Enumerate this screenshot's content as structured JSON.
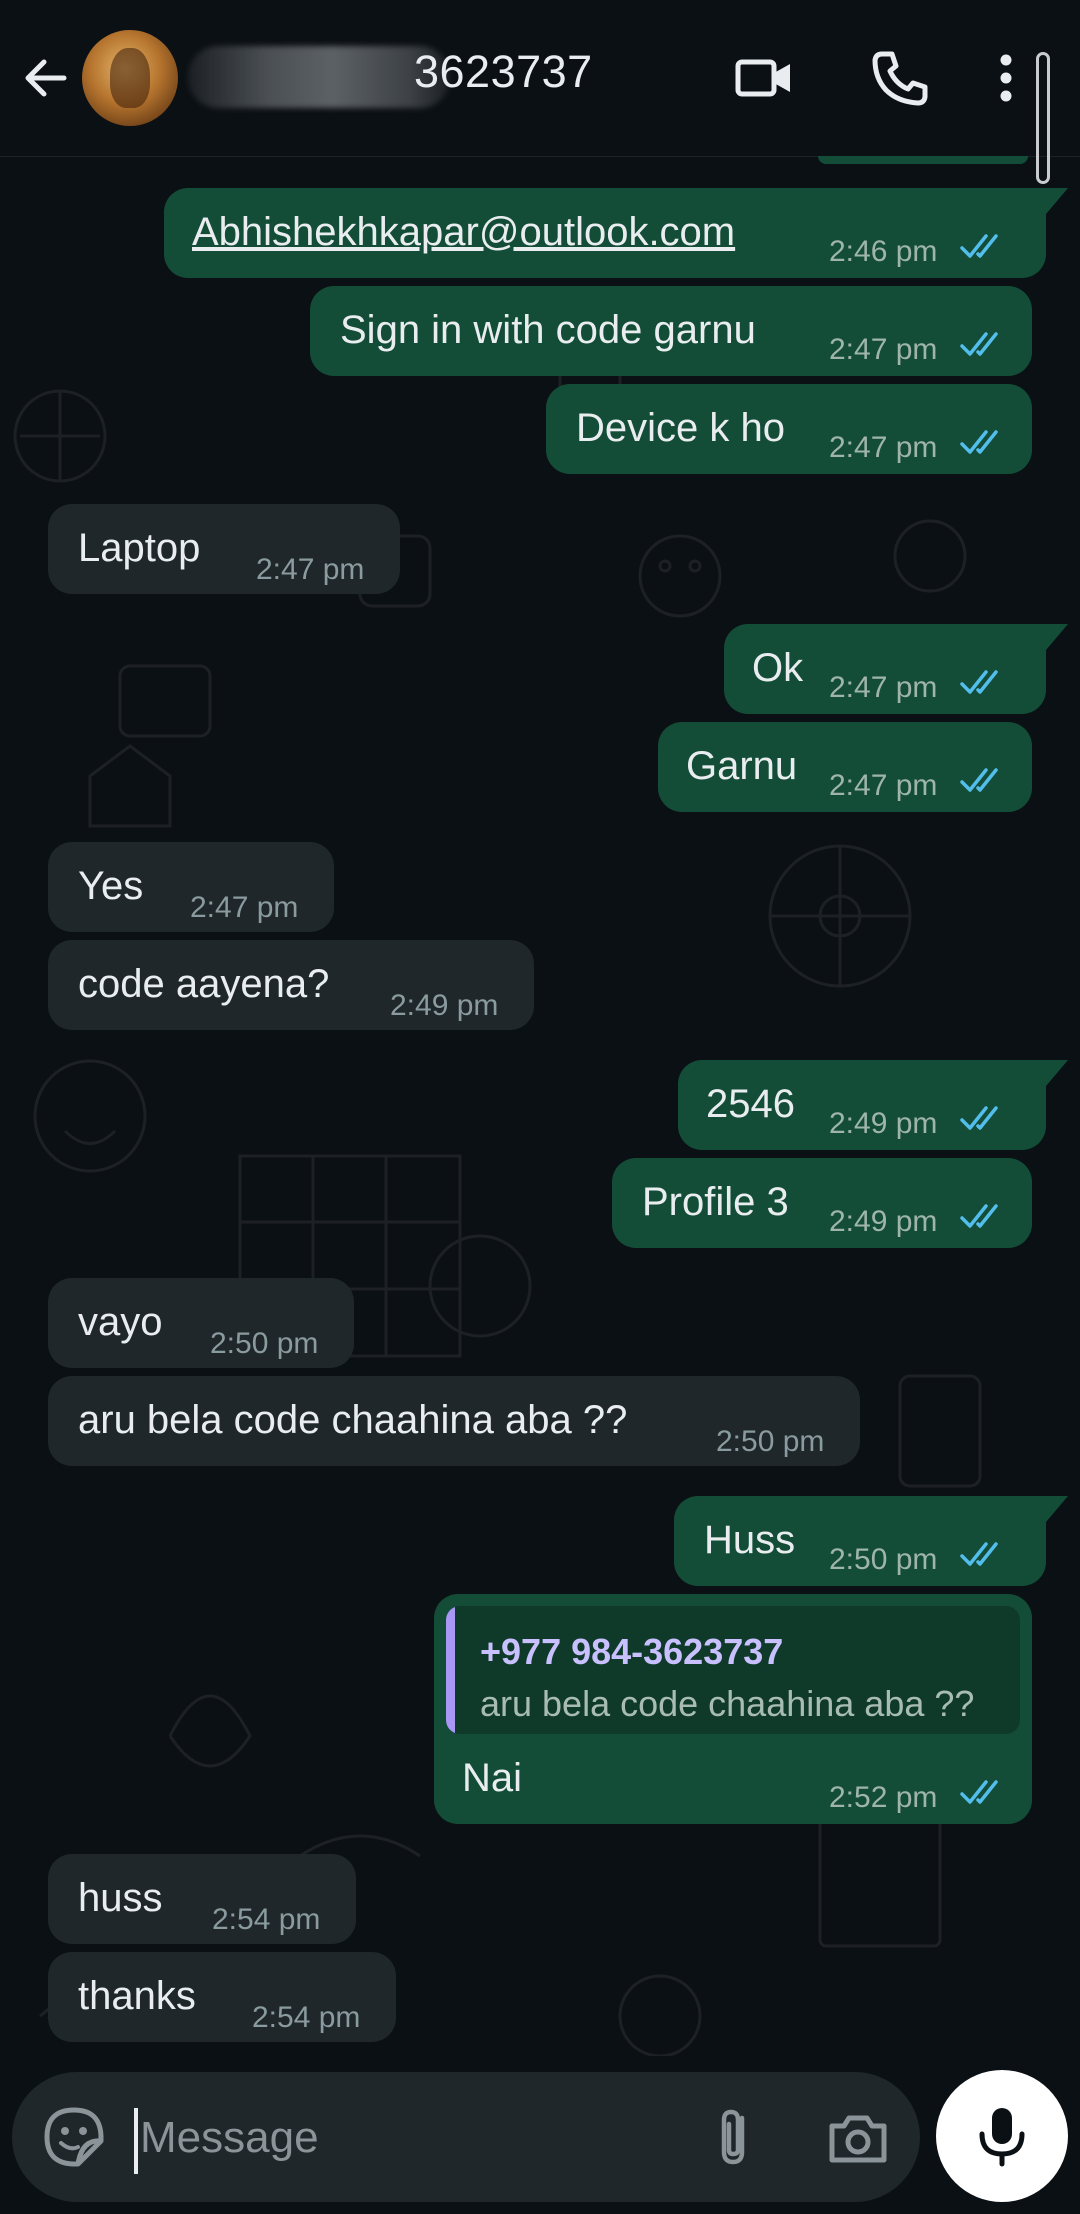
{
  "header": {
    "contact_name_visible": "3623737"
  },
  "messages": [
    {
      "dir": "out",
      "kind": "link",
      "text": "Abhishekhkapar@outlook.com",
      "time": "2:46 pm",
      "status": "read"
    },
    {
      "dir": "out",
      "text": "Sign in with code garnu",
      "time": "2:47 pm",
      "status": "read"
    },
    {
      "dir": "out",
      "text": "Device k ho",
      "time": "2:47 pm",
      "status": "read"
    },
    {
      "dir": "in",
      "text": "Laptop",
      "time": "2:47 pm"
    },
    {
      "dir": "out",
      "text": "Ok",
      "time": "2:47 pm",
      "status": "read"
    },
    {
      "dir": "out",
      "text": "Garnu",
      "time": "2:47 pm",
      "status": "read"
    },
    {
      "dir": "in",
      "text": "Yes",
      "time": "2:47 pm"
    },
    {
      "dir": "in",
      "text": "code aayena?",
      "time": "2:49 pm"
    },
    {
      "dir": "out",
      "text": "2546",
      "time": "2:49 pm",
      "status": "read"
    },
    {
      "dir": "out",
      "text": "Profile 3",
      "time": "2:49 pm",
      "status": "read"
    },
    {
      "dir": "in",
      "text": "vayo",
      "time": "2:50 pm"
    },
    {
      "dir": "in",
      "text": "aru bela code chaahina aba ??",
      "time": "2:50 pm"
    },
    {
      "dir": "out",
      "text": "Huss",
      "time": "2:50 pm",
      "status": "read"
    },
    {
      "dir": "out",
      "kind": "reply",
      "quote_author": "+977 984-3623737",
      "quote_text": "aru bela code chaahina aba ??",
      "text": "Nai",
      "time": "2:52 pm",
      "status": "read"
    },
    {
      "dir": "in",
      "text": "huss",
      "time": "2:54 pm"
    },
    {
      "dir": "in",
      "text": "thanks",
      "time": "2:54 pm"
    }
  ],
  "composer": {
    "placeholder": "Message"
  },
  "colors": {
    "outgoing_bubble": "#134d37",
    "incoming_bubble": "#1f272a",
    "read_ticks": "#53bdeb",
    "background": "#0b1014"
  },
  "icons": [
    "back-arrow-icon",
    "video-call-icon",
    "voice-call-icon",
    "more-options-icon",
    "emoji-sticker-icon",
    "attach-icon",
    "camera-icon",
    "mic-icon"
  ]
}
